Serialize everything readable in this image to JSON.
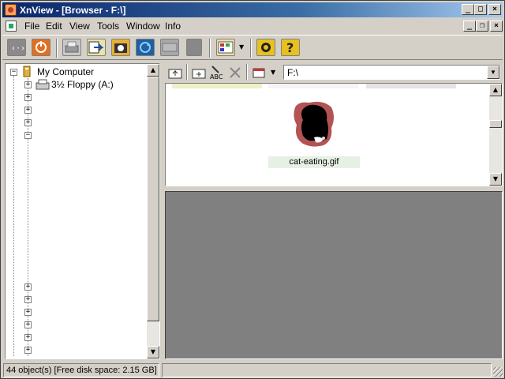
{
  "window": {
    "title": "XnView - [Browser - F:\\]",
    "minimize": "_",
    "maximize": "□",
    "close": "×"
  },
  "menu": {
    "items": [
      "File",
      "Edit",
      "View",
      "Tools",
      "Window",
      "Info"
    ],
    "mdi_minimize": "_",
    "mdi_restore": "❐",
    "mdi_close": "×"
  },
  "tree": {
    "root": "My Computer",
    "floppy": "3½ Floppy (A:)",
    "expander": "+",
    "collapser": "−"
  },
  "address": {
    "path": "F:\\"
  },
  "browser": {
    "selected_caption": "cat-eating.gif"
  },
  "status": {
    "left": "44 object(s) [Free disk space: 2.15 GB]"
  },
  "scroll": {
    "up": "▲",
    "down": "▼"
  },
  "colors": {
    "title_start": "#0a246a",
    "title_end": "#a6caf0",
    "preview_bg": "#808080"
  }
}
